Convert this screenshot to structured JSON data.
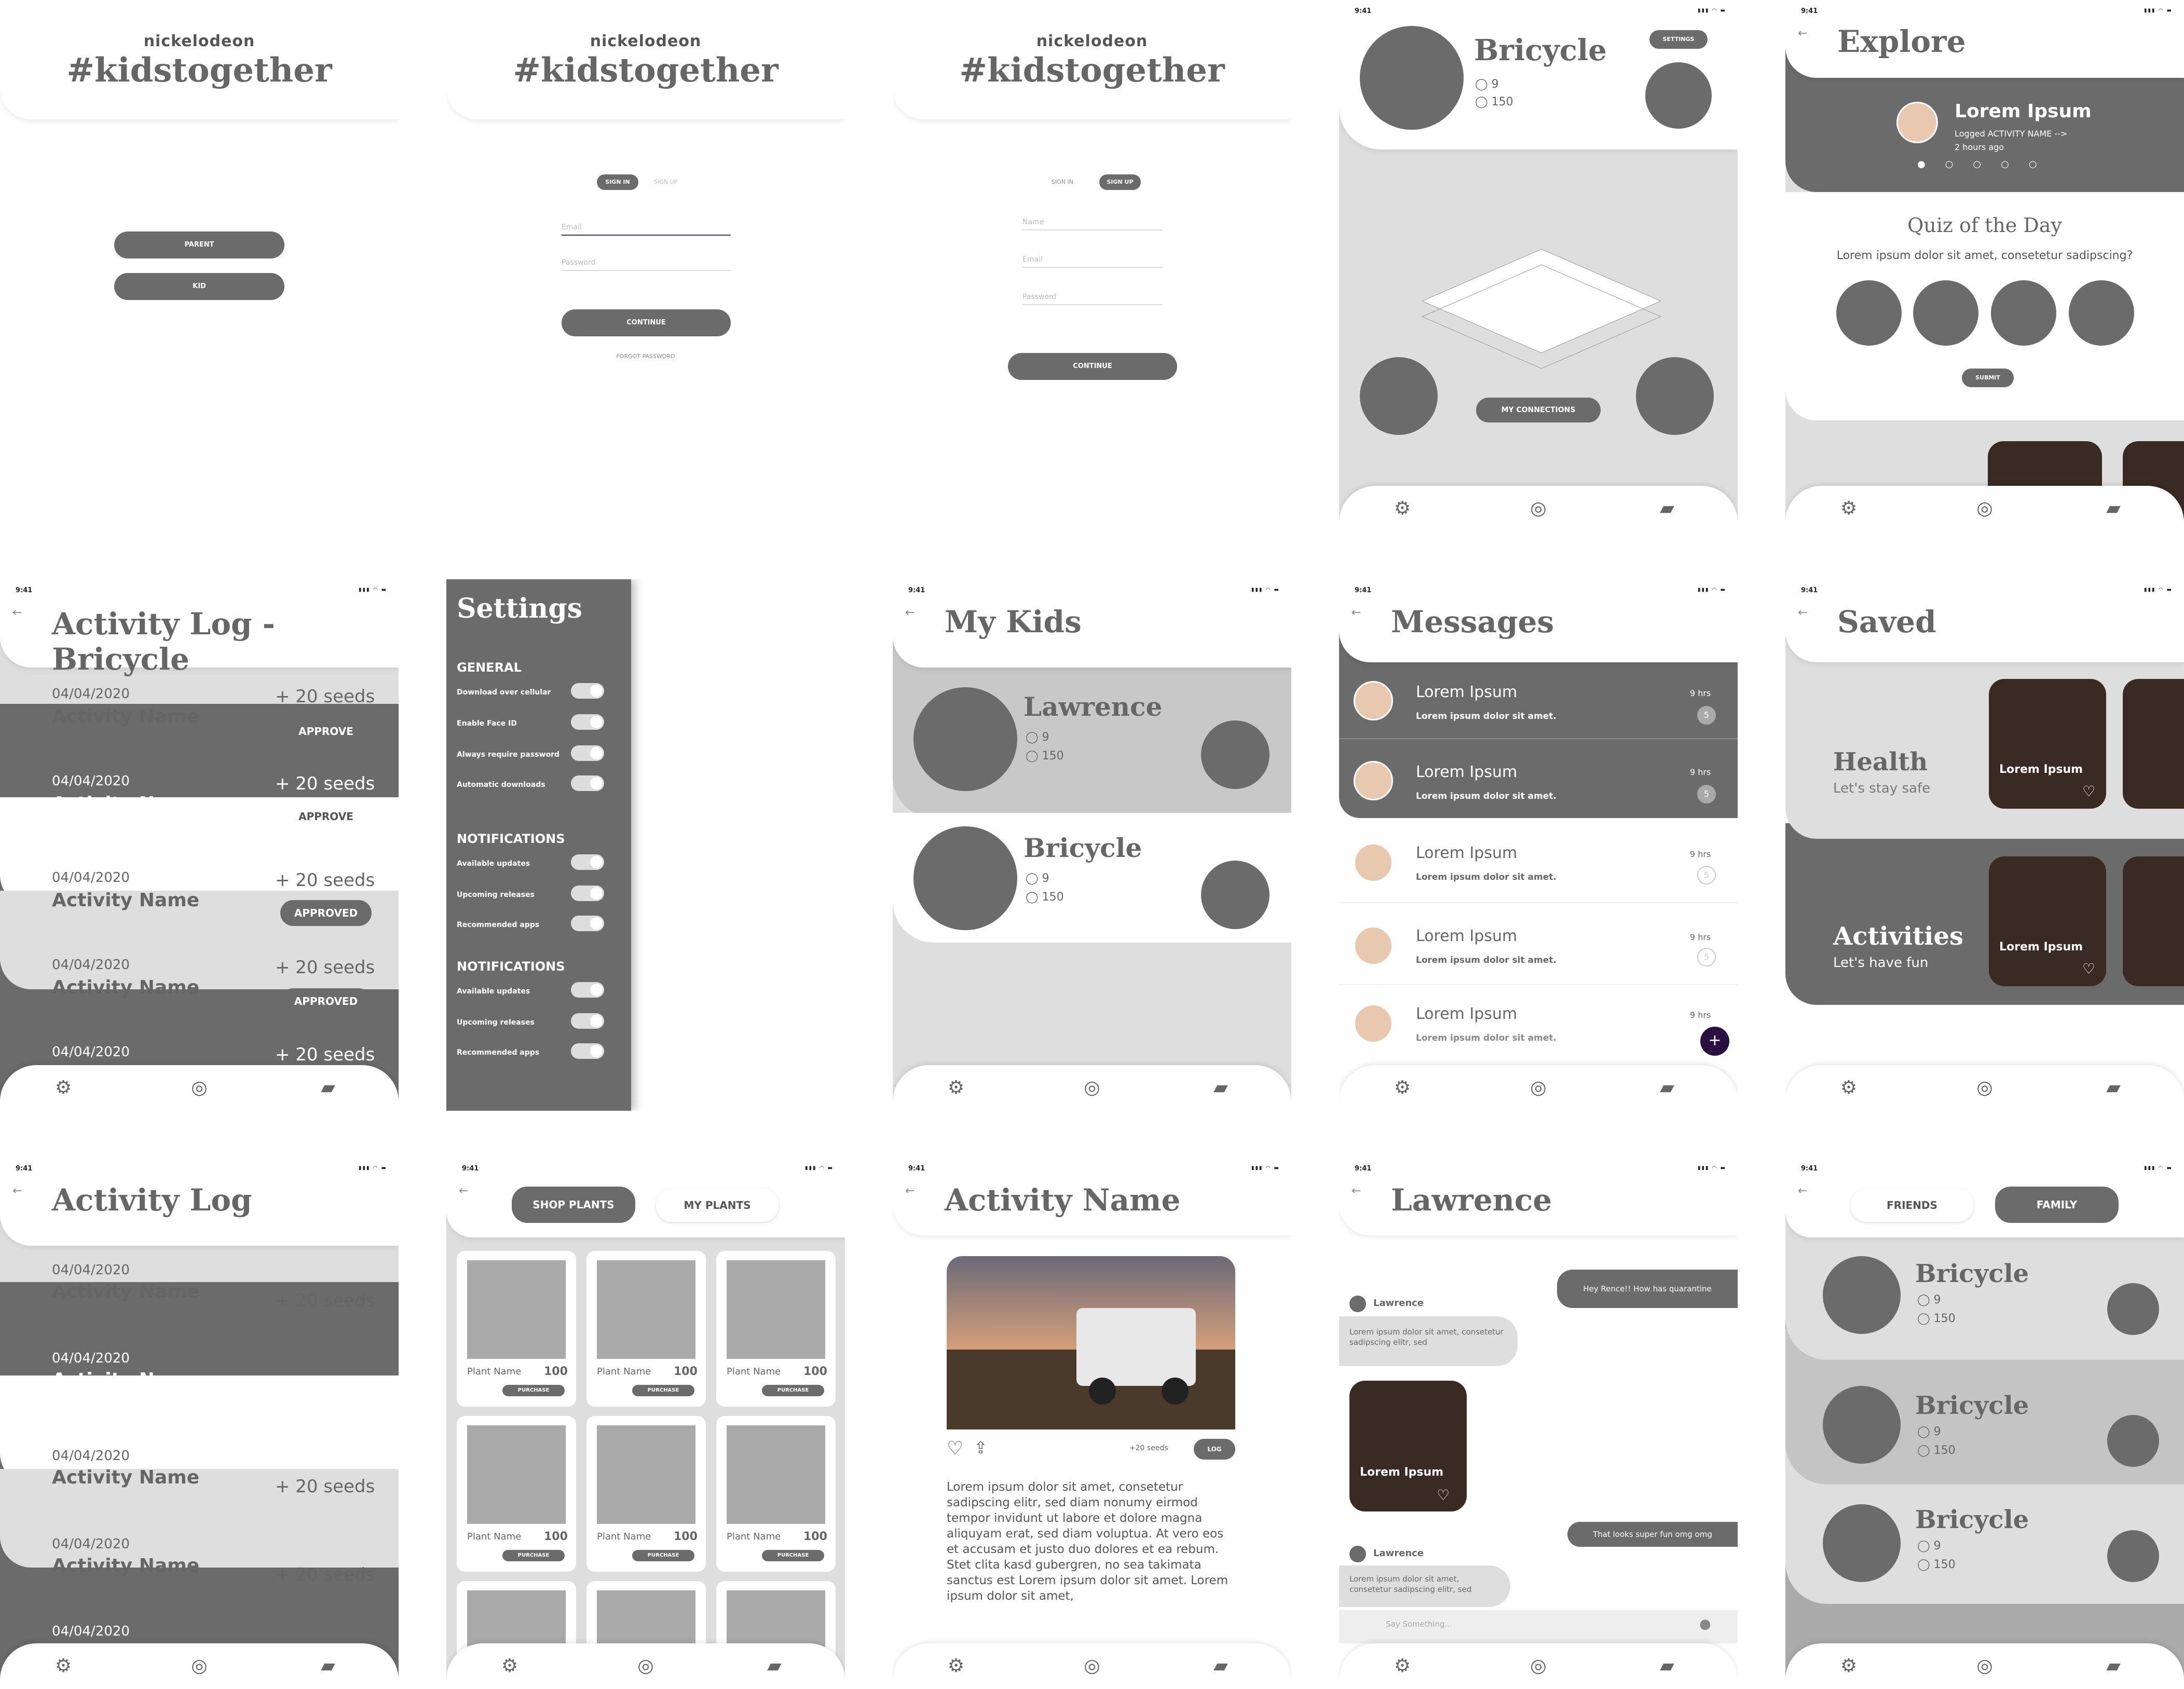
{
  "status_time": "9:41",
  "status_icons": "▮▮▮ ◠ ▬",
  "icons": {
    "settings": "gear-icon",
    "explore": "compass-icon",
    "messages": "chat-icon"
  },
  "colors": {
    "primary": "#6b6b6b",
    "light": "#dedede",
    "white": "#ffffff",
    "accent": "#2a1040"
  },
  "s1": {
    "brand": "nickelodeon",
    "hashtag": "#kidstogether",
    "buttons": [
      "PARENT",
      "KID"
    ]
  },
  "s2": {
    "brand": "nickelodeon",
    "hashtag": "#kidstogether",
    "tab_signin": "SIGN IN",
    "tab_signup": "SIGN UP",
    "email_placeholder": "Email",
    "password_placeholder": "Password",
    "continue": "CONTINUE",
    "forgot": "FORGOT PASSWORD"
  },
  "s3": {
    "brand": "nickelodeon",
    "hashtag": "#kidstogether",
    "tab_signin": "SIGN IN",
    "tab_signup": "SIGN UP",
    "name_placeholder": "Name",
    "email_placeholder": "Email",
    "password_placeholder": "Password",
    "continue": "CONTINUE"
  },
  "s4": {
    "name": "Bricycle",
    "stat1": "9",
    "stat2": "150",
    "settings_btn": "SETTINGS",
    "connections_btn": "MY CONNECTIONS"
  },
  "s5": {
    "title": "Explore",
    "user": "Lorem Ipsum",
    "activity": "Logged ACTIVITY NAME -->",
    "time": "2 hours ago",
    "quiz_title": "Quiz of the Day",
    "quiz_question": "Lorem ipsum dolor sit amet, consetetur sadipscing?",
    "submit": "SUBMIT"
  },
  "s6": {
    "title": "Activity Log - Bricycle",
    "rows": [
      {
        "date": "04/04/2020",
        "name": "Activity Name",
        "seeds": "+ 20 seeds",
        "action": "APPROVE"
      },
      {
        "date": "04/04/2020",
        "name": "Activity Name",
        "seeds": "+ 20 seeds",
        "action": "APPROVE"
      },
      {
        "date": "04/04/2020",
        "name": "Activity Name",
        "seeds": "+ 20 seeds",
        "action": "APPROVED"
      },
      {
        "date": "04/04/2020",
        "name": "Activity Name",
        "seeds": "+ 20 seeds",
        "action": "APPROVED"
      },
      {
        "date": "04/04/2020",
        "name": "",
        "seeds": "+ 20 seeds",
        "action": ""
      }
    ]
  },
  "s7": {
    "title": "Settings",
    "sections": [
      {
        "heading": "GENERAL",
        "items": [
          "Download over cellular",
          "Enable Face ID",
          "Always require password",
          "Automatic downloads"
        ]
      },
      {
        "heading": "NOTIFICATIONS",
        "items": [
          "Available updates",
          "Upcoming releases",
          "Recommended apps"
        ]
      },
      {
        "heading": "NOTIFICATIONS",
        "items": [
          "Available updates",
          "Upcoming releases",
          "Recommended apps"
        ]
      }
    ]
  },
  "s8": {
    "title": "My Kids",
    "kids": [
      {
        "name": "Lawrence",
        "stat1": "9",
        "stat2": "150"
      },
      {
        "name": "Bricycle",
        "stat1": "9",
        "stat2": "150"
      }
    ]
  },
  "s9": {
    "title": "Messages",
    "items": [
      {
        "name": "Lorem Ipsum",
        "text": "Lorem ipsum dolor sit amet.",
        "time": "9 hrs",
        "count": "5"
      },
      {
        "name": "Lorem Ipsum",
        "text": "Lorem ipsum dolor sit amet.",
        "time": "9 hrs",
        "count": "5"
      },
      {
        "name": "Lorem Ipsum",
        "text": "Lorem ipsum dolor sit amet.",
        "time": "9 hrs",
        "count": "5"
      },
      {
        "name": "Lorem Ipsum",
        "text": "Lorem ipsum dolor sit amet.",
        "time": "9 hrs",
        "count": "5"
      },
      {
        "name": "Lorem Ipsum",
        "text": "Lorem ipsum dolor sit amet.",
        "time": "9 hrs",
        "count": ""
      }
    ],
    "fab": "+"
  },
  "s10": {
    "title": "Saved",
    "sections": [
      {
        "title": "Health",
        "subtitle": "Let's stay safe",
        "card": "Lorem Ipsum"
      },
      {
        "title": "Activities",
        "subtitle": "Let's have fun",
        "card": "Lorem Ipsum"
      }
    ]
  },
  "s11": {
    "title": "Activity Log",
    "rows": [
      {
        "date": "04/04/2020",
        "name": "Activity Name",
        "seeds": "+ 20 seeds"
      },
      {
        "date": "04/04/2020",
        "name": "Activity Name",
        "seeds": "+ 20 seeds"
      },
      {
        "date": "04/04/2020",
        "name": "Activity Name",
        "seeds": "+ 20 seeds"
      },
      {
        "date": "04/04/2020",
        "name": "Activity Name",
        "seeds": "+ 20 seeds"
      },
      {
        "date": "04/04/2020",
        "name": "",
        "seeds": ""
      }
    ]
  },
  "s12": {
    "tab_shop": "SHOP PLANTS",
    "tab_mine": "MY PLANTS",
    "plant_name": "Plant Name",
    "price": "100",
    "purchase": "PURCHASE"
  },
  "s13": {
    "title": "Activity Name",
    "seeds": "+20 seeds",
    "log": "LOG",
    "body": "Lorem ipsum dolor sit amet, consetetur sadipscing elitr, sed diam nonumy eirmod tempor invidunt ut labore et dolore magna aliquyam erat, sed diam voluptua. At vero eos et accusam et justo duo dolores et ea rebum. Stet clita kasd gubergren, no sea takimata sanctus est Lorem ipsum dolor sit amet. Lorem ipsum dolor sit amet,"
  },
  "s14": {
    "title": "Lawrence",
    "sent1": "Hey Rence!! How has quarantine",
    "sender": "Lawrence",
    "recv1": "Lorem ipsum dolor sit amet, consetetur sadipscing elitr, sed",
    "image_label": "Lorem Ipsum",
    "sent2": "That looks super fun omg omg",
    "recv2": "Lorem ipsum dolor sit amet, consetetur sadipscing elitr, sed",
    "input_placeholder": "Say Something..."
  },
  "s15": {
    "tab_friends": "FRIENDS",
    "tab_family": "FAMILY",
    "kids": [
      {
        "name": "Bricycle",
        "stat1": "9",
        "stat2": "150"
      },
      {
        "name": "Bricycle",
        "stat1": "9",
        "stat2": "150"
      },
      {
        "name": "Bricycle",
        "stat1": "9",
        "stat2": "150"
      }
    ]
  }
}
